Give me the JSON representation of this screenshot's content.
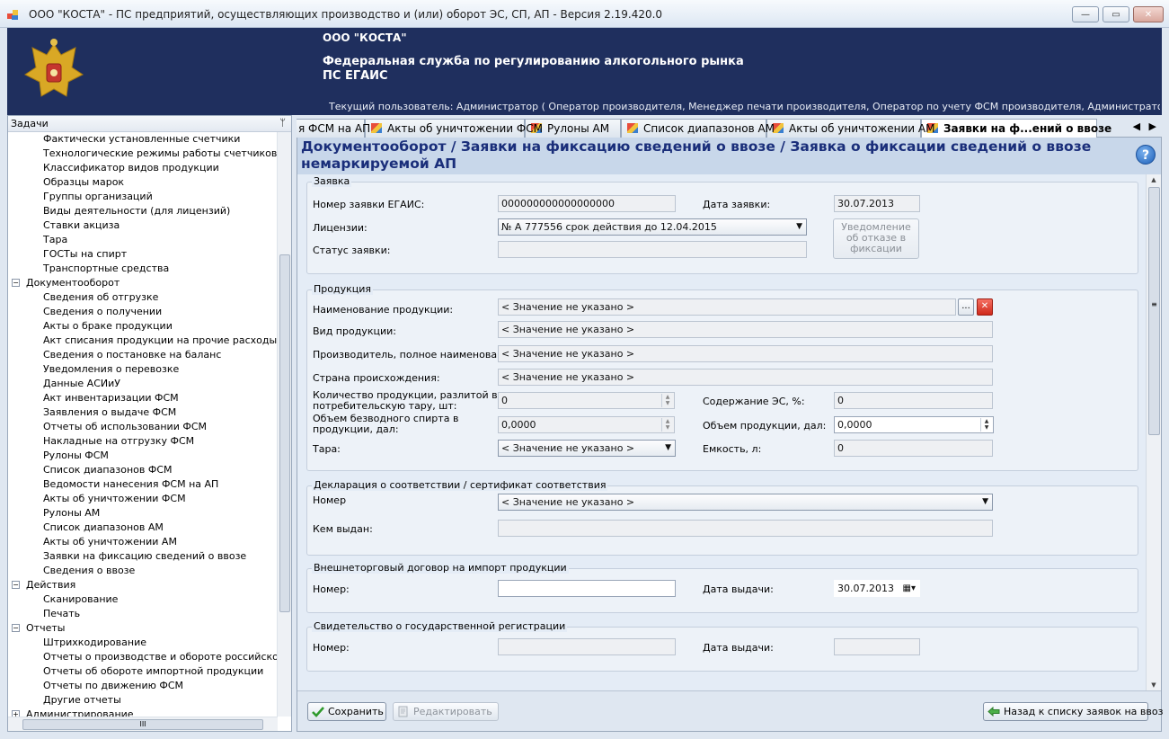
{
  "window": {
    "title": "ООО \"КОСТА\" - ПС предприятий, осуществляющих производство и (или) оборот ЭС, СП, АП - Версия 2.19.420.0",
    "minimize": "—",
    "maximize": "▭",
    "close": "✕"
  },
  "banner": {
    "org": "ООО \"КОСТА\"",
    "agency_line1": "Федеральная служба по регулированию алкогольного рынка",
    "agency_line2": "ПС ЕГАИС",
    "user": "Текущий пользователь: Администратор ( Оператор производителя, Менеджер печати производителя, Оператор по учету ФСМ производителя, Администратор производителя, Оп..."
  },
  "sidebar": {
    "title": "Задачи",
    "pin": "ᛘ",
    "items": [
      {
        "level": 2,
        "label": "Фактически установленные счетчики"
      },
      {
        "level": 2,
        "label": "Технологические режимы работы счетчиков"
      },
      {
        "level": 2,
        "label": "Классификатор видов продукции"
      },
      {
        "level": 2,
        "label": "Образцы марок"
      },
      {
        "level": 2,
        "label": "Группы организаций"
      },
      {
        "level": 2,
        "label": "Виды деятельности (для лицензий)"
      },
      {
        "level": 2,
        "label": "Ставки акциза"
      },
      {
        "level": 2,
        "label": "Тара"
      },
      {
        "level": 2,
        "label": "ГОСТы на спирт"
      },
      {
        "level": 2,
        "label": "Транспортные средства"
      },
      {
        "level": 1,
        "label": "Документооборот",
        "toggle": "−"
      },
      {
        "level": 2,
        "label": "Сведения об отгрузке"
      },
      {
        "level": 2,
        "label": "Сведения о получении"
      },
      {
        "level": 2,
        "label": "Акты о браке продукции"
      },
      {
        "level": 2,
        "label": "Акт списания продукции на прочие расходы"
      },
      {
        "level": 2,
        "label": "Сведения о постановке на баланс"
      },
      {
        "level": 2,
        "label": "Уведомления о перевозке"
      },
      {
        "level": 2,
        "label": "Данные АСИиУ"
      },
      {
        "level": 2,
        "label": "Акт инвентаризации ФСМ"
      },
      {
        "level": 2,
        "label": "Заявления о выдаче ФСМ"
      },
      {
        "level": 2,
        "label": "Отчеты об использовании ФСМ"
      },
      {
        "level": 2,
        "label": "Накладные на отгрузку ФСМ"
      },
      {
        "level": 2,
        "label": "Рулоны ФСМ"
      },
      {
        "level": 2,
        "label": "Список диапазонов ФСМ"
      },
      {
        "level": 2,
        "label": "Ведомости нанесения ФСМ на АП"
      },
      {
        "level": 2,
        "label": "Акты об уничтожении ФСМ"
      },
      {
        "level": 2,
        "label": "Рулоны АМ"
      },
      {
        "level": 2,
        "label": "Список диапазонов АМ"
      },
      {
        "level": 2,
        "label": "Акты об уничтожении АМ"
      },
      {
        "level": 2,
        "label": "Заявки на фиксацию сведений о ввозе"
      },
      {
        "level": 2,
        "label": "Сведения о ввозе"
      },
      {
        "level": 1,
        "label": "Действия",
        "toggle": "−"
      },
      {
        "level": 2,
        "label": "Сканирование"
      },
      {
        "level": 2,
        "label": "Печать"
      },
      {
        "level": 1,
        "label": "Отчеты",
        "toggle": "−"
      },
      {
        "level": 2,
        "label": "Штрихкодирование"
      },
      {
        "level": 2,
        "label": "Отчеты о производстве и обороте российской про"
      },
      {
        "level": 2,
        "label": "Отчеты об обороте импортной продукции"
      },
      {
        "level": 2,
        "label": "Отчеты по движению ФСМ"
      },
      {
        "level": 2,
        "label": "Другие отчеты"
      },
      {
        "level": 1,
        "label": "Администрирование",
        "toggle": "+"
      }
    ],
    "hscroll_grip": "III"
  },
  "tabs": [
    {
      "label": "я ФСМ на АП",
      "icon": false
    },
    {
      "label": "Акты об уничтожении ФСМ",
      "icon": true
    },
    {
      "label": "Рулоны АМ",
      "icon": true
    },
    {
      "label": "Список диапазонов АМ",
      "icon": true
    },
    {
      "label": "Акты об уничтожении АМ",
      "icon": true
    },
    {
      "label": "Заявки на ф...ений о ввозе",
      "icon": true,
      "active": true
    }
  ],
  "tab_nav": {
    "prev": "◀",
    "next": "▶"
  },
  "breadcrumb": "Документооборот / Заявки на фиксацию сведений о ввозе / Заявка о фиксации сведений о ввозе немаркируемой АП",
  "help": "?",
  "form": {
    "zayavka": {
      "title": "Заявка",
      "egais_number_label": "Номер заявки ЕГАИС:",
      "egais_number_value": "000000000000000000",
      "date_label": "Дата заявки:",
      "date_value": "30.07.2013",
      "license_label": "Лицензии:",
      "license_value": "№ А 777556 срок действия до 12.04.2015",
      "status_label": "Статус заявки:",
      "status_value": "",
      "notify_button": "Уведомление об отказе в фиксации"
    },
    "produkciya": {
      "title": "Продукция",
      "name_label": "Наименование продукции:",
      "name_value": "< Значение не указано >",
      "browse": "...",
      "clear": "✕",
      "type_label": "Вид продукции:",
      "type_value": "< Значение не указано >",
      "producer_label": "Производитель, полное наименование:",
      "producer_value": "< Значение не указано >",
      "country_label": "Страна происхождения:",
      "country_value": "< Значение не указано >",
      "qty_label": "Количество продукции, разлитой в потребительскую тару, шт:",
      "qty_value": "0",
      "es_label": "Содержание ЭС, %:",
      "es_value": "0",
      "spirit_label": "Объем безводного спирта в продукции, дал:",
      "spirit_value": "0,0000",
      "volume_label": "Объем продукции, дал:",
      "volume_value": "0,0000",
      "tara_label": "Тара:",
      "tara_value": "< Значение не указано >",
      "capacity_label": "Емкость, л:",
      "capacity_value": "0"
    },
    "declaration": {
      "title": "Декларация о соответствии / сертификат соответствия",
      "number_label": "Номер",
      "number_value": "< Значение не указано >",
      "issued_label": "Кем выдан:",
      "issued_value": ""
    },
    "contract": {
      "title": "Внешнеторговый договор на импорт продукции",
      "number_label": "Номер:",
      "number_value": "",
      "date_label": "Дата выдачи:",
      "date_value": "30.07.2013"
    },
    "registration": {
      "title": "Свидетельство о государственной регистрации",
      "number_label": "Номер:",
      "number_value": "",
      "date_label": "Дата выдачи:",
      "date_value": ""
    }
  },
  "footer": {
    "save": "Сохранить",
    "edit": "Редактировать",
    "back": "Назад к списку заявок на ввоз"
  },
  "colors": {
    "banner": "#1f2f5e",
    "breadcrumb_bg": "#c8d7ea",
    "breadcrumb_text": "#1a2e7a"
  }
}
